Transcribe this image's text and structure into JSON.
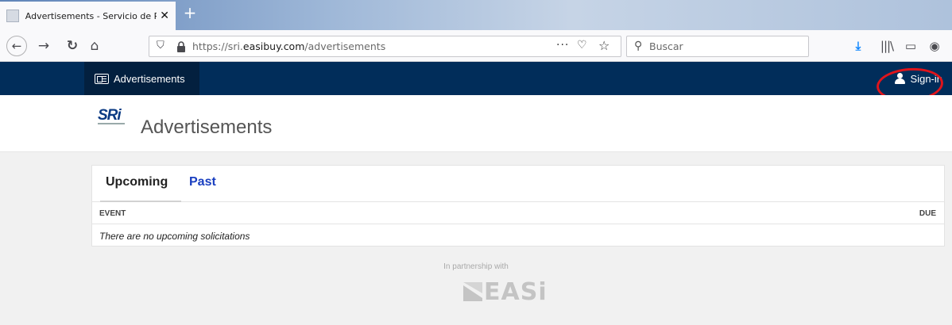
{
  "browser": {
    "tab_title": "Advertisements - Servicio de Re",
    "tab_close": "✕",
    "newtab": "+",
    "url_prefix": "https://sri.",
    "url_domain": "easibuy.com",
    "url_path": "/advertisements",
    "search_placeholder": "Buscar",
    "icons": {
      "back": "back-arrow-icon",
      "forward": "forward-arrow-icon",
      "reload": "reload-icon",
      "home": "home-icon",
      "download": "download-icon",
      "library": "library-icon",
      "sidebar": "sidebar-icon",
      "account": "account-icon"
    }
  },
  "sitenav": {
    "advertisements_label": "Advertisements",
    "signin_label": "Sign-in"
  },
  "header": {
    "logo_text": "SRi",
    "title": "Advertisements"
  },
  "tabs": {
    "upcoming": "Upcoming",
    "past": "Past"
  },
  "table": {
    "columns": [
      "EVENT",
      "DUE"
    ],
    "empty_message": "There are no upcoming solicitations"
  },
  "footer": {
    "partnership_text": "In partnership with",
    "partner_logo_text": "EASi"
  },
  "colors": {
    "nav_bg": "#012d5a",
    "nav_active": "#03203f",
    "link_blue": "#1a3fc0",
    "annotation_red": "#e0141b"
  }
}
